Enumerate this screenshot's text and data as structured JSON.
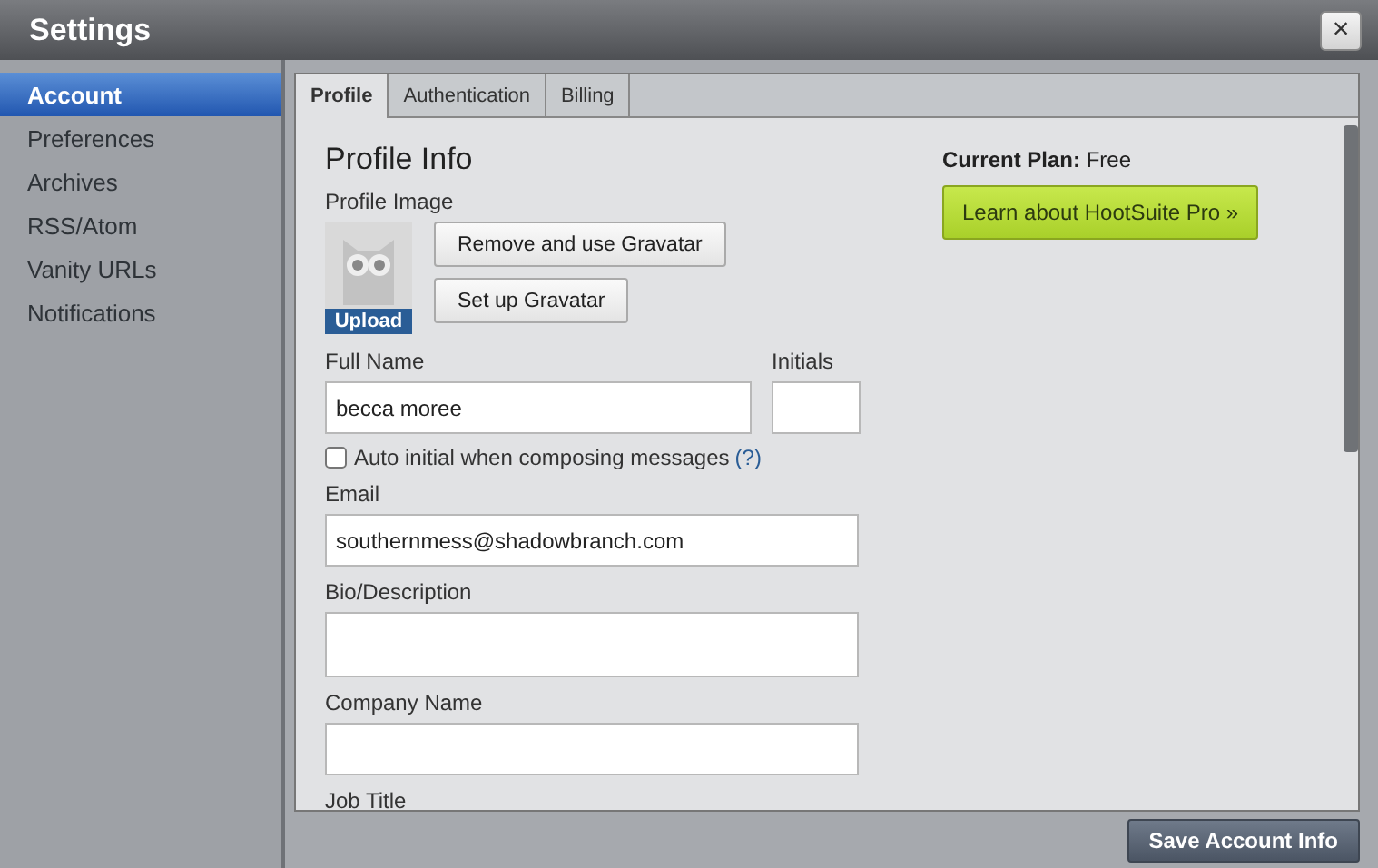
{
  "window": {
    "title": "Settings",
    "close": "×"
  },
  "sidebar": {
    "items": [
      {
        "label": "Account",
        "selected": true
      },
      {
        "label": "Preferences",
        "selected": false
      },
      {
        "label": "Archives",
        "selected": false
      },
      {
        "label": "RSS/Atom",
        "selected": false
      },
      {
        "label": "Vanity URLs",
        "selected": false
      },
      {
        "label": "Notifications",
        "selected": false
      }
    ]
  },
  "tabs": [
    {
      "label": "Profile",
      "selected": true
    },
    {
      "label": "Authentication",
      "selected": false
    },
    {
      "label": "Billing",
      "selected": false
    }
  ],
  "profile": {
    "heading": "Profile Info",
    "image_label": "Profile Image",
    "upload": "Upload",
    "image_buttons": [
      "Remove and use Gravatar",
      "Set up Gravatar"
    ],
    "full_name": {
      "label": "Full Name",
      "value": "becca moree"
    },
    "initials": {
      "label": "Initials"
    },
    "auto_initial": {
      "label": "Auto initial when composing messages",
      "help": "(?)",
      "checked": false
    },
    "fields": [
      {
        "label": "Email",
        "value": "southernmess@shadowbranch.com",
        "kind": "input"
      },
      {
        "label": "Bio/Description",
        "kind": "textarea"
      },
      {
        "label": "Company Name",
        "kind": "input"
      },
      {
        "label": "Job Title",
        "kind": "cut"
      }
    ]
  },
  "plan": {
    "text": "**Current Plan:** Free",
    "button": "Learn about HootSuite Pro »"
  },
  "save_button": "Save Account Info"
}
